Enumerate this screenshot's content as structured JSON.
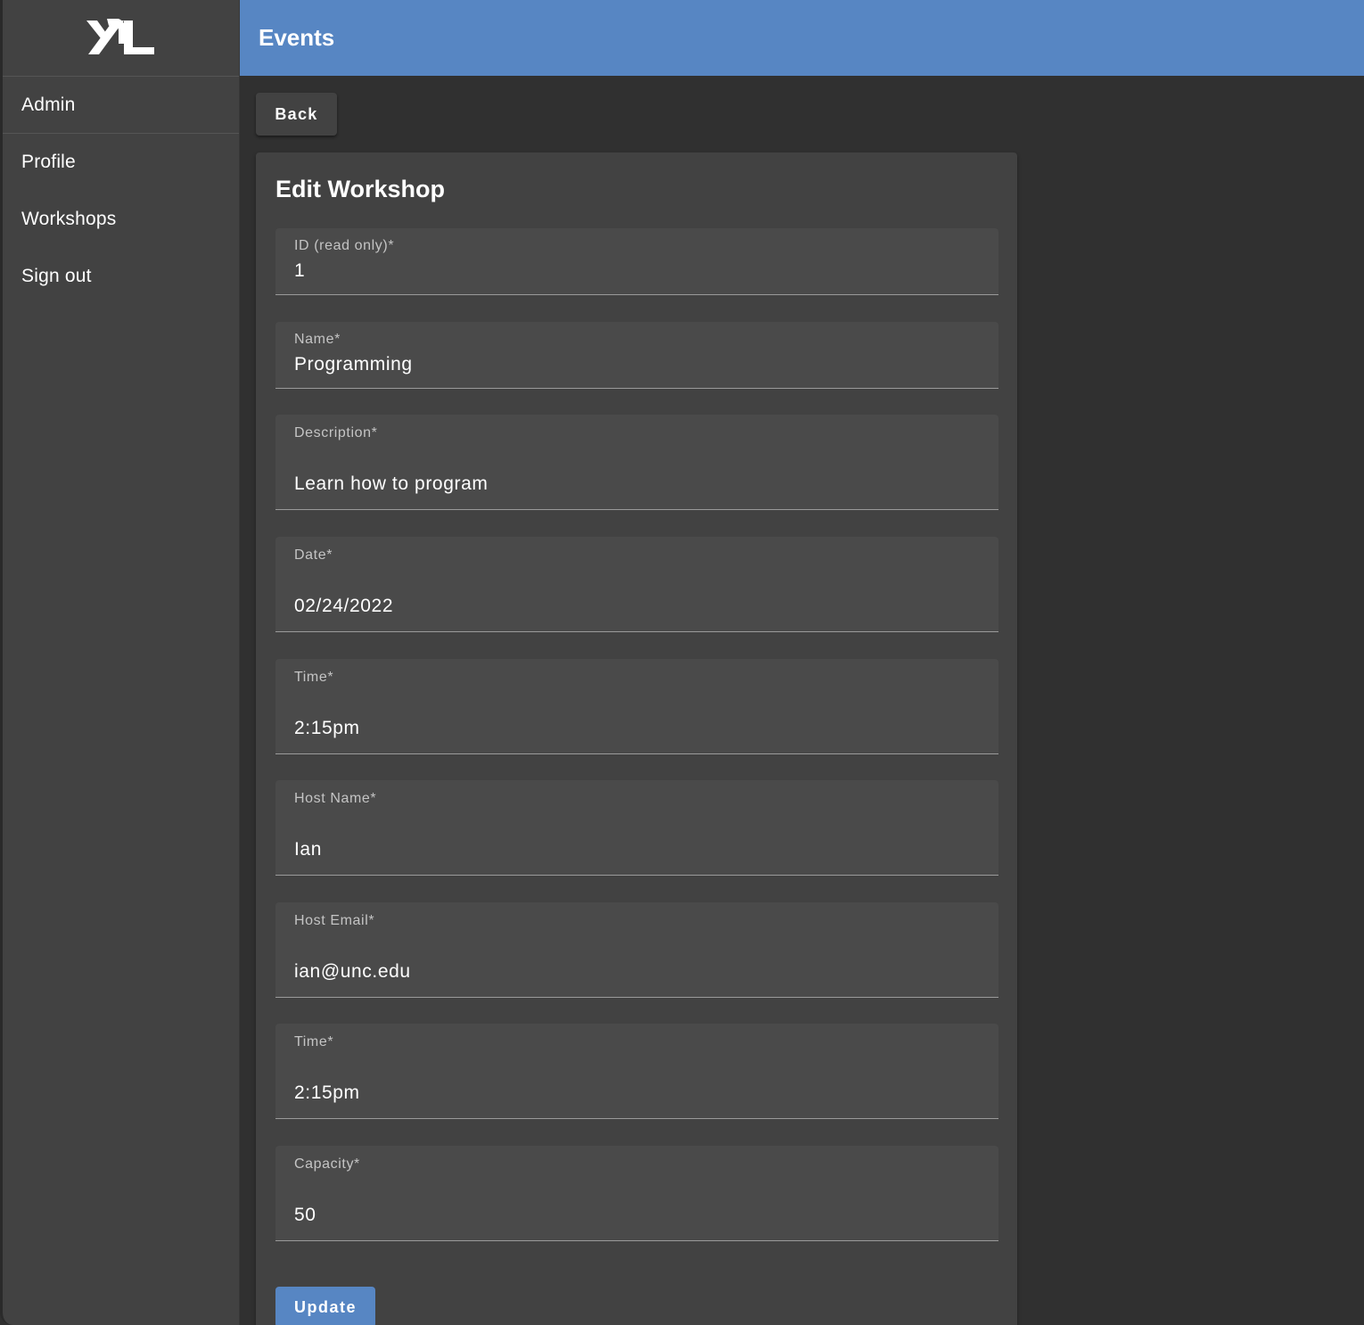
{
  "app": {
    "logo_icon": "xl-logo-icon",
    "header_title": "Events"
  },
  "sidebar": {
    "items": [
      {
        "label": "Admin"
      },
      {
        "label": "Profile"
      },
      {
        "label": "Workshops"
      },
      {
        "label": "Sign out"
      }
    ]
  },
  "actions": {
    "back_label": "Back",
    "update_label": "Update"
  },
  "form": {
    "title": "Edit Workshop",
    "fields": [
      {
        "label": "ID (read only)*",
        "value": "1"
      },
      {
        "label": "Name*",
        "value": "Programming"
      },
      {
        "label": "Description*",
        "value": "Learn how to program"
      },
      {
        "label": "Date*",
        "value": "02/24/2022"
      },
      {
        "label": "Time*",
        "value": "2:15pm"
      },
      {
        "label": "Host Name*",
        "value": "Ian"
      },
      {
        "label": "Host Email*",
        "value": "ian@unc.edu"
      },
      {
        "label": "Time*",
        "value": "2:15pm"
      },
      {
        "label": "Capacity*",
        "value": "50"
      }
    ]
  },
  "colors": {
    "accent": "#5786c3",
    "background": "#303030",
    "surface": "#424242",
    "field_fill": "#4a4a4a"
  }
}
